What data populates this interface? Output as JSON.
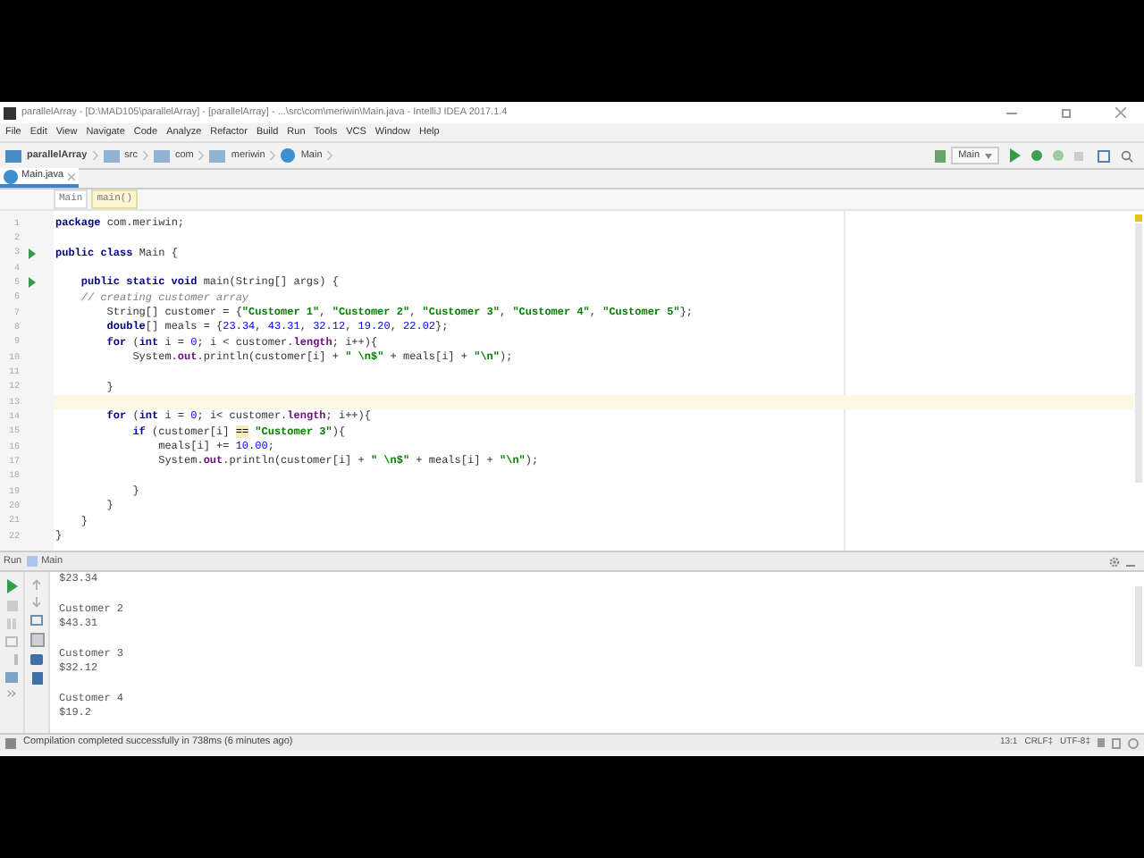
{
  "window": {
    "title": "parallelArray - [D:\\MAD105\\parallelArray] - [parallelArray] - ...\\src\\com\\meriwin\\Main.java - IntelliJ IDEA 2017.1.4"
  },
  "menu": [
    "File",
    "Edit",
    "View",
    "Navigate",
    "Code",
    "Analyze",
    "Refactor",
    "Build",
    "Run",
    "Tools",
    "VCS",
    "Window",
    "Help"
  ],
  "nav_bar": {
    "breadcrumbs": [
      {
        "label": "parallelArray",
        "kind": "project"
      },
      {
        "label": "src",
        "kind": "folder"
      },
      {
        "label": "com",
        "kind": "folder"
      },
      {
        "label": "meriwin",
        "kind": "folder"
      },
      {
        "label": "Main",
        "kind": "class"
      }
    ],
    "run_config": "Main"
  },
  "tabs": [
    {
      "label": "Main.java",
      "selected": true
    }
  ],
  "structure_path": [
    {
      "label": "Main",
      "selected": false
    },
    {
      "label": "main()",
      "selected": true
    }
  ],
  "editor": {
    "lines": [
      {
        "number": "1",
        "run_marker": false,
        "current": false,
        "tokens": [
          {
            "kind": "keyword",
            "text": "package"
          },
          {
            "kind": "plain",
            "text": " com.meriwin;"
          }
        ]
      },
      {
        "number": "2",
        "run_marker": false,
        "current": false
      },
      {
        "number": "3",
        "run_marker": true,
        "current": false,
        "tokens": [
          {
            "kind": "keyword",
            "text": "public class"
          },
          {
            "kind": "plain",
            "text": " Main {"
          }
        ]
      },
      {
        "number": "4",
        "run_marker": false,
        "current": false
      },
      {
        "number": "5",
        "run_marker": true,
        "current": false,
        "tokens": [
          {
            "kind": "keyword",
            "text": "    public static void"
          },
          {
            "kind": "plain",
            "text": " main(String[] args) {"
          }
        ]
      },
      {
        "number": "6",
        "run_marker": false,
        "current": false,
        "tokens": [
          {
            "kind": "comment",
            "text": "    // creating customer array"
          }
        ]
      },
      {
        "number": "7",
        "run_marker": false,
        "current": false,
        "tokens": [
          {
            "kind": "plain",
            "text": "        String[] customer = {"
          },
          {
            "kind": "string",
            "text": "\"Customer 1\""
          },
          {
            "kind": "plain",
            "text": ", "
          },
          {
            "kind": "string",
            "text": "\"Customer 2\""
          },
          {
            "kind": "plain",
            "text": ", "
          },
          {
            "kind": "string",
            "text": "\"Customer 3\""
          },
          {
            "kind": "plain",
            "text": ", "
          },
          {
            "kind": "string",
            "text": "\"Customer 4\""
          },
          {
            "kind": "plain",
            "text": ", "
          },
          {
            "kind": "string",
            "text": "\"Customer 5\""
          },
          {
            "kind": "plain",
            "text": "};"
          }
        ]
      },
      {
        "number": "8",
        "run_marker": false,
        "current": false,
        "tokens": [
          {
            "kind": "keyword",
            "text": "        double"
          },
          {
            "kind": "plain",
            "text": "[] meals = {"
          },
          {
            "kind": "number",
            "text": "23.34"
          },
          {
            "kind": "plain",
            "text": ", "
          },
          {
            "kind": "number",
            "text": "43.31"
          },
          {
            "kind": "plain",
            "text": ", "
          },
          {
            "kind": "number",
            "text": "32.12"
          },
          {
            "kind": "plain",
            "text": ", "
          },
          {
            "kind": "number",
            "text": "19.20"
          },
          {
            "kind": "plain",
            "text": ", "
          },
          {
            "kind": "number",
            "text": "22.02"
          },
          {
            "kind": "plain",
            "text": "};"
          }
        ]
      },
      {
        "number": "9",
        "run_marker": false,
        "current": false,
        "tokens": [
          {
            "kind": "keyword",
            "text": "        for"
          },
          {
            "kind": "plain",
            "text": " ("
          },
          {
            "kind": "keyword",
            "text": "int"
          },
          {
            "kind": "plain",
            "text": " i = "
          },
          {
            "kind": "number",
            "text": "0"
          },
          {
            "kind": "plain",
            "text": "; i < customer."
          },
          {
            "kind": "field",
            "text": "length"
          },
          {
            "kind": "plain",
            "text": "; i++){"
          }
        ]
      },
      {
        "number": "10",
        "run_marker": false,
        "current": false,
        "tokens": [
          {
            "kind": "plain",
            "text": "            System."
          },
          {
            "kind": "field",
            "text": "out"
          },
          {
            "kind": "plain",
            "text": ".println(customer[i] + "
          },
          {
            "kind": "string",
            "text": "\" \\n$\""
          },
          {
            "kind": "plain",
            "text": " + meals[i] + "
          },
          {
            "kind": "string",
            "text": "\"\\n\""
          },
          {
            "kind": "plain",
            "text": ");"
          }
        ]
      },
      {
        "number": "11",
        "run_marker": false,
        "current": false
      },
      {
        "number": "12",
        "run_marker": false,
        "current": false,
        "tokens": [
          {
            "kind": "plain",
            "text": "        }"
          }
        ]
      },
      {
        "number": "13",
        "run_marker": false,
        "current": true
      },
      {
        "number": "14",
        "run_marker": false,
        "current": false,
        "tokens": [
          {
            "kind": "keyword",
            "text": "        for"
          },
          {
            "kind": "plain",
            "text": " ("
          },
          {
            "kind": "keyword",
            "text": "int"
          },
          {
            "kind": "plain",
            "text": " i = "
          },
          {
            "kind": "number",
            "text": "0"
          },
          {
            "kind": "plain",
            "text": "; i< customer."
          },
          {
            "kind": "field",
            "text": "length"
          },
          {
            "kind": "plain",
            "text": "; i++){"
          }
        ]
      },
      {
        "number": "15",
        "run_marker": false,
        "current": false,
        "tokens": [
          {
            "kind": "keyword",
            "text": "            if"
          },
          {
            "kind": "plain",
            "text": " (customer[i] "
          },
          {
            "kind": "warning",
            "text": "=="
          },
          {
            "kind": "string",
            "text": " \"Customer 3\""
          },
          {
            "kind": "plain",
            "text": "){"
          }
        ]
      },
      {
        "number": "16",
        "run_marker": false,
        "current": false,
        "tokens": [
          {
            "kind": "plain",
            "text": "                meals[i] += "
          },
          {
            "kind": "number",
            "text": "10.00"
          },
          {
            "kind": "plain",
            "text": ";"
          }
        ]
      },
      {
        "number": "17",
        "run_marker": false,
        "current": false,
        "tokens": [
          {
            "kind": "plain",
            "text": "                System."
          },
          {
            "kind": "field",
            "text": "out"
          },
          {
            "kind": "plain",
            "text": ".println(customer[i] + "
          },
          {
            "kind": "string",
            "text": "\" \\n$\""
          },
          {
            "kind": "plain",
            "text": " + meals[i] + "
          },
          {
            "kind": "string",
            "text": "\"\\n\""
          },
          {
            "kind": "plain",
            "text": ");"
          }
        ]
      },
      {
        "number": "18",
        "run_marker": false,
        "current": false
      },
      {
        "number": "19",
        "run_marker": false,
        "current": false,
        "tokens": [
          {
            "kind": "plain",
            "text": "            }"
          }
        ]
      },
      {
        "number": "20",
        "run_marker": false,
        "current": false,
        "tokens": [
          {
            "kind": "plain",
            "text": "        }"
          }
        ]
      },
      {
        "number": "21",
        "run_marker": false,
        "current": false,
        "tokens": [
          {
            "kind": "plain",
            "text": "    }"
          }
        ]
      },
      {
        "number": "22",
        "run_marker": false,
        "current": false,
        "tokens": [
          {
            "kind": "plain",
            "text": "}"
          }
        ]
      }
    ]
  },
  "run_panel": {
    "title": "Run",
    "config": "Main",
    "output_blocks": [
      {
        "lines": [
          "$23.34"
        ]
      },
      {
        "lines": [
          "Customer 2",
          "$43.31"
        ]
      },
      {
        "lines": [
          "Customer 3",
          "$32.12"
        ]
      },
      {
        "lines": [
          "Customer 4",
          "$19.2"
        ]
      }
    ]
  },
  "status_bar": {
    "message": "Compilation completed successfully in 738ms (6 minutes ago)",
    "position": "13:1",
    "line_separator": "CRLF‡",
    "encoding": "UTF-8‡"
  }
}
